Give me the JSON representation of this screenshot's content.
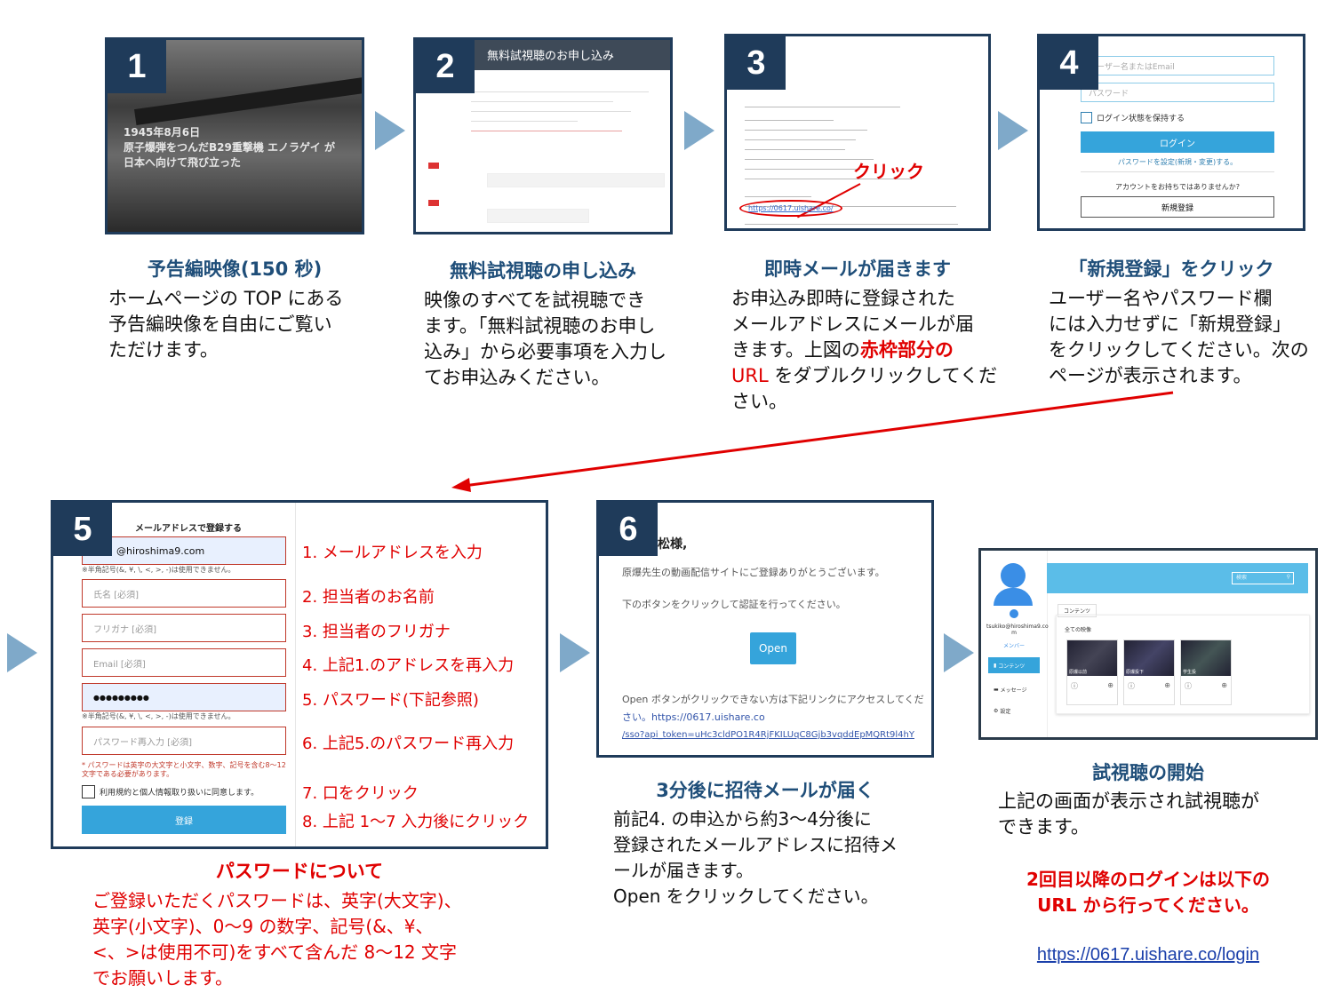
{
  "colors": {
    "navy": "#1f3b5a",
    "title_blue": "#1f4e79",
    "red": "#e00000",
    "button_blue": "#35a4db",
    "chevron": "#7fa9c9"
  },
  "steps": [
    {
      "num": "1",
      "title": "予告編映像(150 秒)",
      "body": [
        "ホームページの TOP にある",
        "予告編映像を自由にご覧い",
        "ただけます。"
      ],
      "screen": {
        "overlay_lines": [
          "1945年8月6日",
          "原子爆弾をつんだB29重撃機 エノラゲイ が",
          "日本へ向けて飛び立った"
        ]
      }
    },
    {
      "num": "2",
      "title": "無料試視聴の申し込み",
      "body": [
        "映像のすべてを試視聴でき",
        "ます。「無料試視聴のお申し",
        "込み」から必要事項を入力し",
        "てお申込みください。"
      ],
      "screen": {
        "header": "無料試視聴のお申し込み"
      }
    },
    {
      "num": "3",
      "title": "即時メールが届きます",
      "body_prefix": [
        "お申込み即時に登録された",
        "メールアドレスにメールが届",
        "きます。上図の"
      ],
      "body_red1": "赤枠部分の",
      "body_red2": "URL",
      "body_suffix1": " をダブルクリックしてくだ",
      "body_suffix2": "さい。",
      "screen": {
        "click_label": "クリック",
        "url": "https://0617.uishare.co/"
      }
    },
    {
      "num": "4",
      "title": "「新規登録」をクリック",
      "body": [
        "ユーザー名やパスワード欄",
        "には入力せずに「新規登録」",
        "をクリックしてください。次の",
        "ページが表示されます。"
      ],
      "screen": {
        "user_placeholder": "ユーザー名またはEmail",
        "password_placeholder": "パスワード",
        "remember": "ログイン状態を保持する",
        "login_button": "ログイン",
        "reset_link": "パスワードを設定(新規・変更)する。",
        "no_account": "アカウントをお持ちではありませんか?",
        "register_button": "新規登録"
      }
    },
    {
      "num": "5",
      "screen": {
        "header": "メールアドレスで登録する",
        "email_value": "@hiroshima9.com",
        "hint": "※半角記号(&, ¥, \\, <, >, -)は使用できません。",
        "name_placeholder": "氏名 [必須]",
        "kana_placeholder": "フリガナ [必須]",
        "email2_placeholder": "Email [必須]",
        "password_value": "●●●●●●●●●",
        "password2_placeholder": "パスワード再入力 [必須]",
        "pw_note": "* パスワードは英字の大文字と小文字、数字、記号を含む8〜12文字である必要があります。",
        "agree": "利用規約と個人情報取り扱いに同意します。",
        "submit": "登録"
      },
      "notes": [
        "1. メールアドレスを入力",
        "2. 担当者のお名前",
        "3. 担当者のフリガナ",
        "4. 上記1.のアドレスを再入力",
        "5. パスワード(下記参照)",
        "6. 上記5.のパスワード再入力",
        "7. 口をクリック",
        "8. 上記 1〜7 入力後にクリック"
      ],
      "pw_title": "パスワードについて",
      "pw_body": [
        "ご登録いただくパスワードは、英字(大文字)、",
        "英字(小文字)、0〜9  の数字、記号(&、¥、",
        "<、>は使用不可)をすべて含んだ 8〜12 文字",
        "でお願いします。"
      ]
    },
    {
      "num": "6",
      "title": "3分後に招待メールが届く",
      "body": [
        "前記4. の申込から約3〜4分後に",
        "登録されたメールアドレスに招待メ",
        "ールが届きます。",
        "Open  をクリックしてください。"
      ],
      "screen": {
        "greeting": "松様,",
        "line1": "原爆先生の動画配信サイトにご登録ありがとうございます。",
        "line2": "下のボタンをクリックして認証を行ってください。",
        "open_button": "Open",
        "fallback1": "Open ボタンがクリックできない方は下記リンクにアクセスしてくだ",
        "fallback2": "さい。https://0617.uishare.co",
        "fallback3": "/sso?api_token=uHc3cldPO1R4RjFKILUqC8Gjb3vqddEpMQRt9l4hY"
      }
    },
    {
      "num": "",
      "title": "試視聴の開始",
      "body": [
        "上記の画面が表示され試視聴が",
        "できます。"
      ],
      "red_note": [
        "2回目以降のログインは以下の",
        "URL  から行ってください。"
      ],
      "login_url": "https://0617.uishare.co/login",
      "screen": {
        "search": "検索",
        "tab": "コンテンツ",
        "section": "全ての映像",
        "user": "tsukiko@hiroshima9.co m",
        "role": "メンバー",
        "nav": [
          "コンテンツ",
          "メッセージ",
          "設定"
        ],
        "video_titles": [
          "原爆以前",
          "原爆投下",
          "学生投"
        ]
      }
    }
  ]
}
